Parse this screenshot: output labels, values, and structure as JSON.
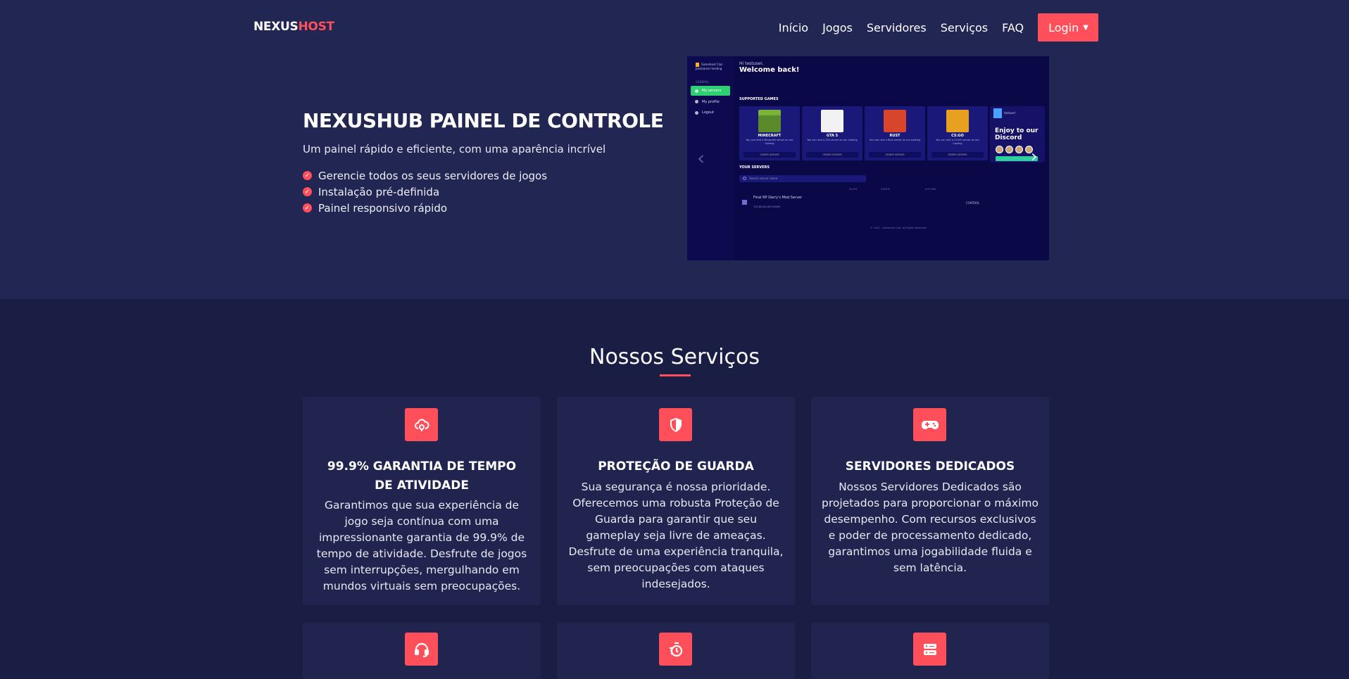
{
  "brand": {
    "name_main": "NEXUS",
    "name_accent": "HOST",
    "accent_color": "#ff4f5a"
  },
  "nav": {
    "items": [
      "Início",
      "Jogos",
      "Servidores",
      "Serviços",
      "FAQ"
    ],
    "login_label": "Login"
  },
  "hero": {
    "title": "NEXUSHUB PAINEL DE CONTROLE",
    "subtitle": "Um painel rápido e eficiente, com uma aparência incrível",
    "features": [
      "Gerencie todos os seus servidores de jogos",
      "Instalação pré-definida",
      "Painel responsivo rápido"
    ]
  },
  "preview": {
    "brand": "Gamehost Cloz Jakdsarner hosting",
    "section_general": "GENERAL",
    "menu": [
      "My servers",
      "My profile",
      "Logout"
    ],
    "greeting": "Hi testuser,",
    "welcome": "Welcome back!",
    "supported_games": "SUPPORTED GAMES",
    "games": [
      {
        "name": "MINECRAFT",
        "desc": "You can rent a Minecraft server on our hosting",
        "color": "#5a8a2a",
        "icon": "minecraft-icon"
      },
      {
        "name": "GTA 5",
        "desc": "You can rent a GTA server on our hosting",
        "color": "#eeeeee",
        "icon": "gta5-icon"
      },
      {
        "name": "RUST",
        "desc": "You can rent a Rust server on our hosting",
        "color": "#d9442c",
        "icon": "rust-icon"
      },
      {
        "name": "CS:GO",
        "desc": "You can rent a CS:GO server on our hosting",
        "color": "#e8a020",
        "icon": "csgo-icon"
      }
    ],
    "order_label": "ORDER SERVER",
    "discord_user": "testuser",
    "discord_sub": "account settings",
    "discord_title": "Enjoy to our Discord",
    "your_servers": "YOUR SERVERS",
    "search_placeholder": "Search server name",
    "columns": [
      "SLOTS",
      "STATUS",
      "ACTIONS"
    ],
    "server_name": "Final RP Darry's Mod Server",
    "server_ip": "192.85.85.169:25565",
    "control_label": "CONTROL",
    "footer": "© 2023 - Gamehost Cloz. All Rights Reserved"
  },
  "services": {
    "title": "Nossos Serviços",
    "cards": [
      {
        "icon": "cloud-uptime-icon",
        "title": "99.9% GARANTIA DE TEMPO DE ATIVIDADE",
        "text": "Garantimos que sua experiência de jogo seja contínua com uma impressionante garantia de 99.9% de tempo de atividade. Desfrute de jogos sem interrupções, mergulhando em mundos virtuais sem preocupações."
      },
      {
        "icon": "shield-icon",
        "title": "PROTEÇÃO DE GUARDA",
        "text": "Sua segurança é nossa prioridade. Oferecemos uma robusta Proteção de Guarda para garantir que seu gameplay seja livre de ameaças. Desfrute de uma experiência tranquila, sem preocupações com ataques indesejados."
      },
      {
        "icon": "gamepad-icon",
        "title": "SERVIDORES DEDICADOS",
        "text": "Nossos Servidores Dedicados são projetados para proporcionar o máximo desempenho. Com recursos exclusivos e poder de processamento dedicado, garantimos uma jogabilidade fluida e sem latência."
      },
      {
        "icon": "headset-icon",
        "title": "",
        "text": ""
      },
      {
        "icon": "stopwatch-icon",
        "title": "",
        "text": ""
      },
      {
        "icon": "server-icon",
        "title": "",
        "text": ""
      }
    ]
  }
}
